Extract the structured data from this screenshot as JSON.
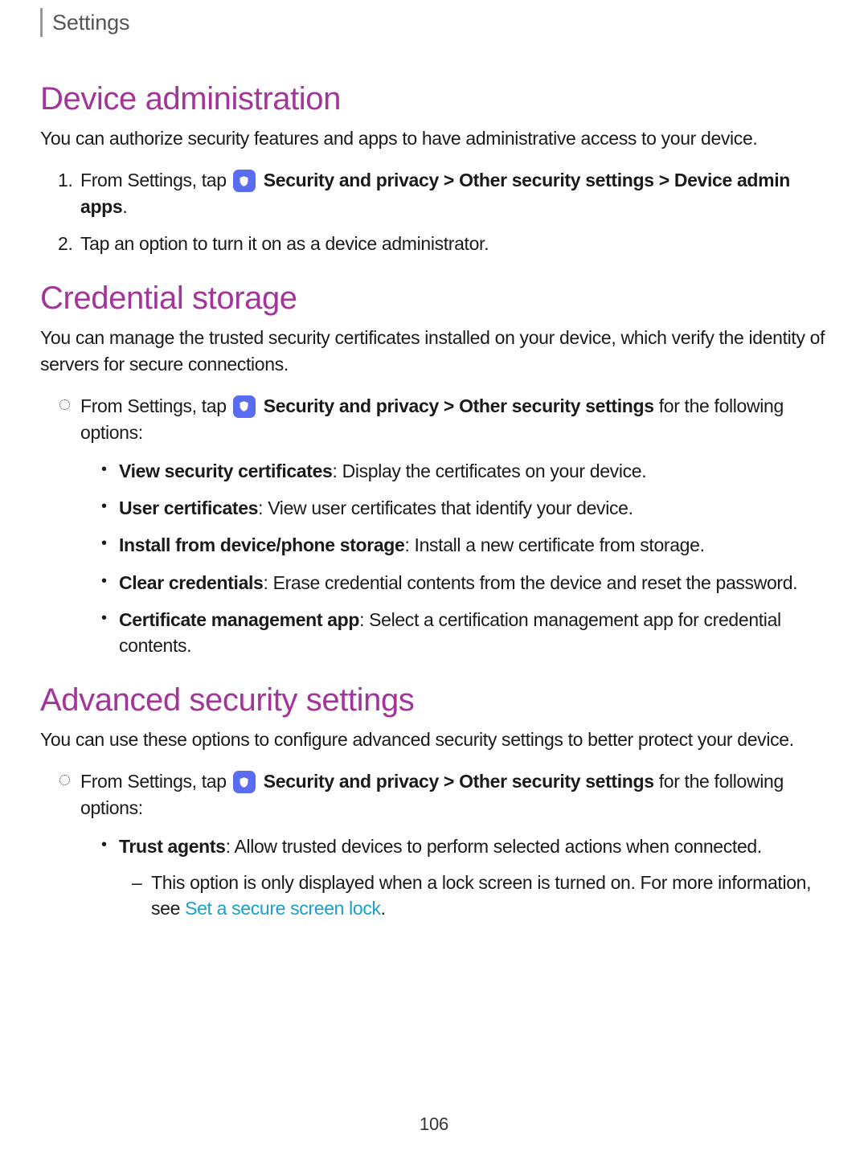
{
  "breadcrumb": "Settings",
  "page_number": "106",
  "sections": {
    "device_admin": {
      "title": "Device administration",
      "desc": "You can authorize security features and apps to have administrative access to your device.",
      "step1_prefix": "From Settings, tap ",
      "step1_bold1": "Security and privacy > Other security settings > Device admin apps",
      "step1_period": ".",
      "step2": "Tap an option to turn it on as a device administrator."
    },
    "credential_storage": {
      "title": "Credential storage",
      "desc": "You can manage the trusted security certificates installed on your device, which verify the identity of servers for secure connections.",
      "bullet_prefix": "From Settings, tap ",
      "bullet_bold": "Security and privacy > Other security settings",
      "bullet_suffix": " for the following options:",
      "options": {
        "o1_b": "View security certificates",
        "o1_t": ": Display the certificates on your device.",
        "o2_b": "User certificates",
        "o2_t": ": View user certificates that identify your device.",
        "o3_b": "Install from device/phone storage",
        "o3_t": ": Install a new certificate from storage.",
        "o4_b": "Clear credentials",
        "o4_t": ": Erase credential contents from the device and reset the password.",
        "o5_b": "Certificate management app",
        "o5_t": ": Select a certification management app for credential contents."
      }
    },
    "advanced": {
      "title": "Advanced security settings",
      "desc": "You can use these options to configure advanced security settings to better protect your device.",
      "bullet_prefix": "From Settings, tap ",
      "bullet_bold": "Security and privacy > Other security settings",
      "bullet_suffix": " for the following options:",
      "trust_b": "Trust agents",
      "trust_t": ": Allow trusted devices to perform selected actions when connected.",
      "dash_prefix": "This option is only displayed when a lock screen is turned on. For more information, see ",
      "dash_link": "Set a secure screen lock",
      "dash_period": "."
    }
  }
}
